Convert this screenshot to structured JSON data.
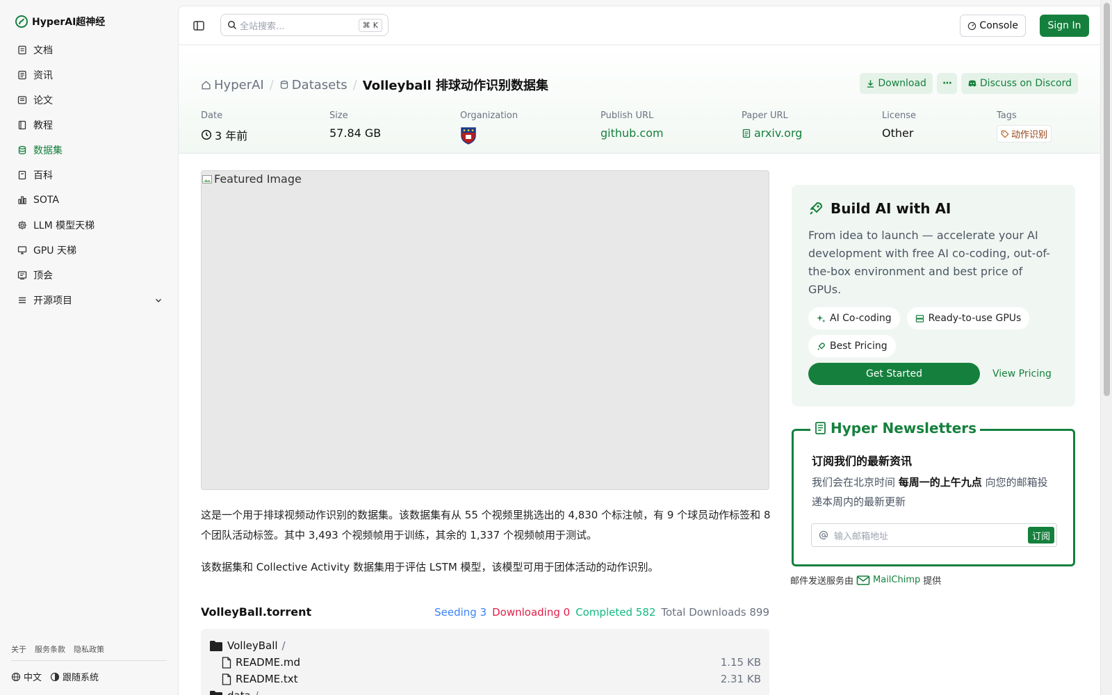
{
  "app": {
    "brand": "HyperAI超神经"
  },
  "sidebar": {
    "items": [
      {
        "label": "文档",
        "icon": "doc-icon"
      },
      {
        "label": "资讯",
        "icon": "news-icon"
      },
      {
        "label": "论文",
        "icon": "paper-icon"
      },
      {
        "label": "教程",
        "icon": "book-icon"
      },
      {
        "label": "数据集",
        "icon": "database-icon",
        "active": true
      },
      {
        "label": "百科",
        "icon": "wiki-icon"
      },
      {
        "label": "SOTA",
        "icon": "chart-icon"
      },
      {
        "label": "LLM 模型天梯",
        "icon": "chip-icon"
      },
      {
        "label": "GPU 天梯",
        "icon": "monitor-icon"
      },
      {
        "label": "顶会",
        "icon": "conference-icon"
      },
      {
        "label": "开源项目",
        "icon": "list-icon"
      }
    ],
    "footer": {
      "about": "关于",
      "terms": "服务条款",
      "privacy": "隐私政策"
    },
    "lang": "中文",
    "theme": "跟随系统"
  },
  "topbar": {
    "search_placeholder": "全站搜索...",
    "search_kbd": "K",
    "console": "Console",
    "signin": "Sign In"
  },
  "breadcrumb": {
    "home": "HyperAI",
    "section": "Datasets",
    "current": "Volleyball 排球动作识别数据集"
  },
  "actions": {
    "download": "Download",
    "more": "···",
    "discord": "Discuss on Discord"
  },
  "meta": {
    "date_label": "Date",
    "date_value": "3 年前",
    "size_label": "Size",
    "size_value": "57.84 GB",
    "org_label": "Organization",
    "publish_label": "Publish URL",
    "publish_value": "github.com",
    "paper_label": "Paper URL",
    "paper_value": "arxiv.org",
    "license_label": "License",
    "license_value": "Other",
    "tags_label": "Tags",
    "tag_value": "动作识别"
  },
  "content": {
    "featured_alt": "Featured Image",
    "p1": "这是一个用于排球视频动作识别的数据集。该数据集有从 55 个视频里挑选出的 4,830 个标注帧，有 9 个球员动作标签和 8 个团队活动标签。其中 3,493 个视频帧用于训练，其余的 1,337 个视频帧用于测试。",
    "p2": "该数据集和 Collective Activity 数据集用于评估 LSTM 模型，该模型可用于团体活动的动作识别。"
  },
  "torrent": {
    "name": "VolleyBall.torrent",
    "seeding": "Seeding 3",
    "downloading": "Downloading 0",
    "completed": "Completed 582",
    "total": "Total Downloads 899",
    "files": [
      {
        "name": "VolleyBall",
        "type": "folder",
        "size": ""
      },
      {
        "name": "README.md",
        "type": "file",
        "size": "1.15 KB"
      },
      {
        "name": "README.txt",
        "type": "file",
        "size": "2.31 KB"
      },
      {
        "name": "data",
        "type": "folder",
        "size": ""
      }
    ]
  },
  "promo": {
    "title": "Build AI with AI",
    "text": "From idea to launch — accelerate your AI development with free AI co-coding, out-of-the-box environment and best price of GPUs.",
    "chip1": "AI Co-coding",
    "chip2": "Ready-to-use GPUs",
    "chip3": "Best Pricing",
    "cta": "Get Started",
    "pricing": "View Pricing"
  },
  "newsletter": {
    "title": "Hyper Newsletters",
    "subtitle": "订阅我们的最新资讯",
    "text_pre": "我们会在北京时间 ",
    "text_bold": "每周一的上午九点",
    "text_post": " 向您的邮箱投递本周内的最新更新",
    "placeholder": "输入邮箱地址",
    "subscribe": "订阅",
    "provider_pre": "邮件发送服务由",
    "provider": "MailChimp",
    "provider_post": "提供"
  },
  "colors": {
    "accent": "#15803d",
    "seeding": "#3b82f6",
    "downloading": "#e11d48",
    "completed": "#10b981"
  }
}
